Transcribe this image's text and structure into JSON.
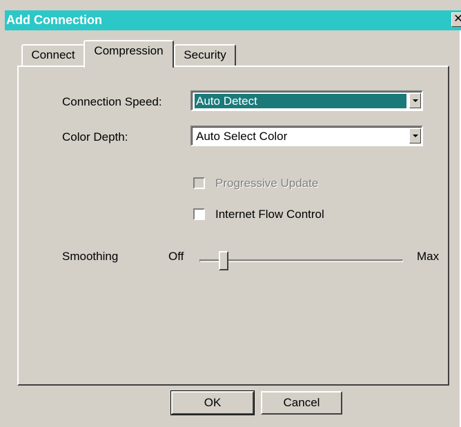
{
  "window": {
    "title": "Add Connection",
    "close_glyph": "✕"
  },
  "tabs": [
    {
      "label": "Connect",
      "active": false
    },
    {
      "label": "Compression",
      "active": true
    },
    {
      "label": "Security",
      "active": false
    }
  ],
  "compression": {
    "connection_speed": {
      "label": "Connection Speed:",
      "value": "Auto Detect"
    },
    "color_depth": {
      "label": "Color Depth:",
      "value": "Auto Select Color"
    },
    "progressive_update": {
      "label": "Progressive Update",
      "checked": false,
      "enabled": false
    },
    "internet_flow_control": {
      "label": "Internet Flow Control",
      "checked": false,
      "enabled": true
    },
    "smoothing": {
      "label": "Smoothing",
      "min_label": "Off",
      "max_label": "Max",
      "level": 0.1
    }
  },
  "buttons": {
    "ok": "OK",
    "cancel": "Cancel"
  },
  "colors": {
    "title_bar": "#2cc7c7",
    "selection": "#1a7a7a",
    "face": "#d4d0c8"
  },
  "icons": {
    "dropdown": "chevron-down-icon",
    "close": "close-icon"
  }
}
